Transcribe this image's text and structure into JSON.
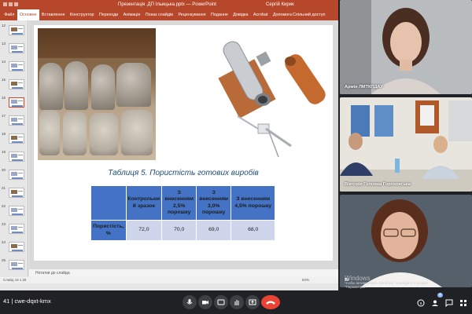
{
  "ppt": {
    "title": "Презентація .ДП Ільицька.pptx — PowerPoint",
    "user": "Сергій Кирик",
    "tabs": [
      "Файл",
      "Основне",
      "Вставлення",
      "Конструктор",
      "Переходи",
      "Анімація",
      "Показ слайдів",
      "Рецензування",
      "Подання",
      "Довідка",
      "Acrobat",
      "Допомога"
    ],
    "active_tab": "Основне",
    "share": "Спільний доступ",
    "thumb_numbers": [
      "12",
      "13",
      "14",
      "15",
      "16",
      "17",
      "18",
      "19",
      "20",
      "21",
      "22",
      "23",
      "24",
      "25"
    ],
    "active_thumb": "16",
    "notes_placeholder": "Нотатки до слайда",
    "status": "Слайд 16 з 25",
    "zoom": "84%"
  },
  "slide": {
    "table_title": "Таблиця 5. Пористість готових виробів",
    "headers": [
      "Контрольни й зразок",
      "З внесенням 2,5% порошку",
      "З внесенням 3,0% порошку",
      "З внесенням 4,5% порошку"
    ],
    "row_label": "Пористість, %",
    "values": [
      "72,0",
      "70,0",
      "69,0",
      "68,0"
    ]
  },
  "participants": [
    {
      "name": "Армін ЛМТКПДАУ"
    },
    {
      "name": "Вікторія Головна Гороховська"
    },
    {
      "name": "Ві"
    }
  ],
  "windows_activation": {
    "big": "Windows",
    "line1": "Чтобы активировать Windows, перейдите в раздел",
    "line2": "\"Параметры\"."
  },
  "meeting": {
    "time_code": "41 | cwe-dqxt-kmx",
    "controls": [
      "mic-icon",
      "camera-icon",
      "captions-icon",
      "raise-hand-icon",
      "present-icon",
      "more-icon",
      "end-call-icon"
    ],
    "right_controls": [
      "info-icon",
      "people-icon",
      "chat-icon",
      "activities-icon"
    ],
    "people_count": "4"
  },
  "colors": {
    "ppt_brand": "#b7472a",
    "table_header": "#4472c4",
    "table_cell": "#cfd5ea",
    "title_text": "#1e4e79",
    "end_call": "#ea4335"
  }
}
